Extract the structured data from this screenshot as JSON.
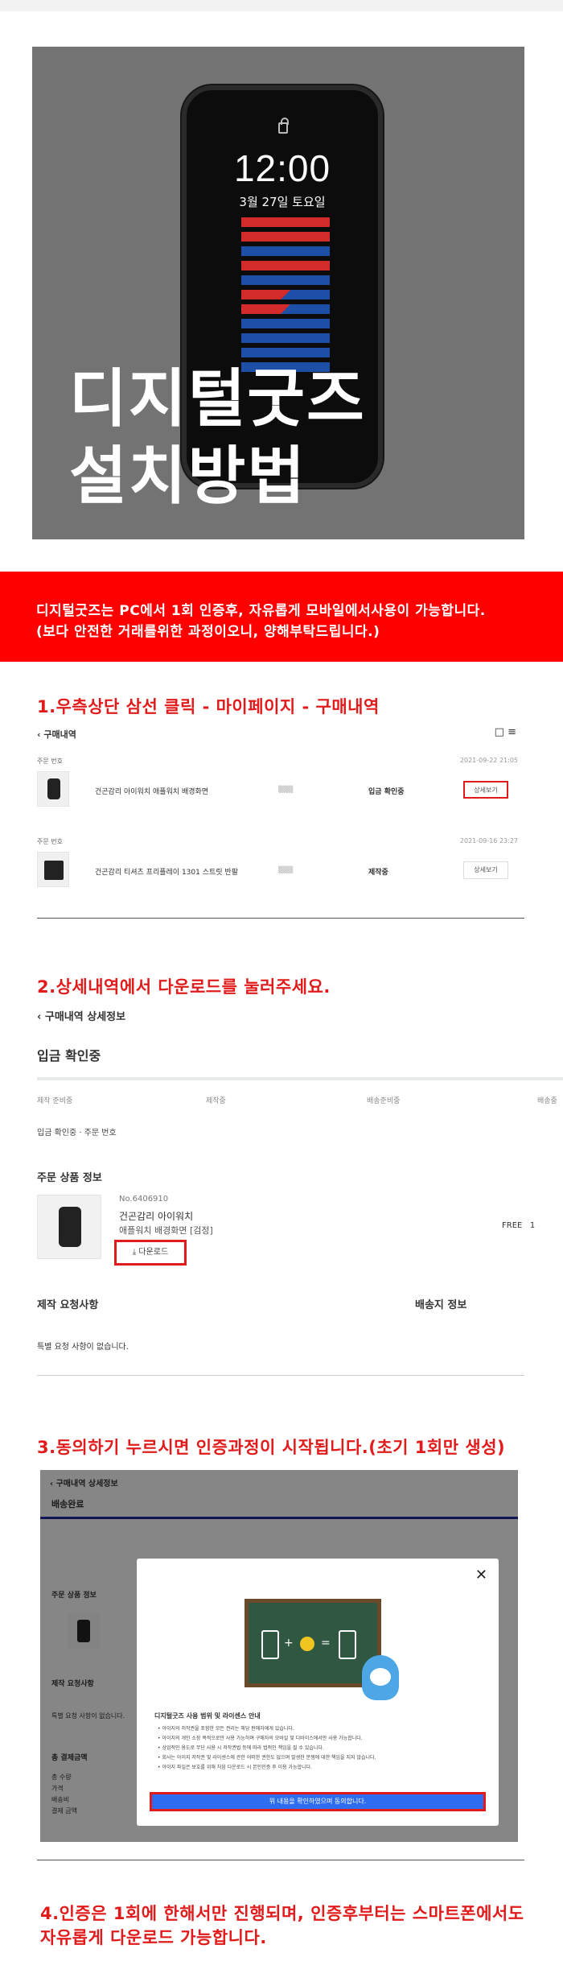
{
  "hero": {
    "title_line1": "디지털굿즈",
    "title_line2": "설치방법",
    "lockscreen_time": "12:00",
    "lockscreen_date": "3월 27일 토요일"
  },
  "notice": {
    "line1": "디지털굿즈는 PC에서 1회 인증후, 자유롭게 모바일에서사용이 가능합니다.",
    "line2": "(보다 안전한 거래를위한 과정이오니, 양해부탁드립니다.)"
  },
  "step1": {
    "title": "1.우측상단 삼선 클릭 - 마이페이지 - 구매내역",
    "header": "구매내역",
    "orders": [
      {
        "no": "주문 번호",
        "date": "2021-09-22 21:05",
        "name": "건곤감리 아이워치 애플워치 배경화면",
        "status": "입금 확인중",
        "button": "상세보기"
      },
      {
        "no": "주문 번호",
        "date": "2021-09-16 23:27",
        "name": "건곤감리 티셔츠 프리플레이 1301 스트릿 반팔",
        "status": "제작중",
        "button": "상세보기"
      }
    ]
  },
  "step2": {
    "title": "2.상세내역에서 다운로드를 눌러주세요.",
    "header": "구매내역 상세정보",
    "status": "입금 확인중",
    "steps": [
      "제작 준비중",
      "제작중",
      "배송준비중",
      "배송중"
    ],
    "order_info": "입금 확인중 · 주문 번호",
    "product_section": "주문 상품 정보",
    "product_no": "No.6406910",
    "product_name": "건곤감리 아이워치",
    "product_option": "애플워치 배경화면 [검정]",
    "download": "다운로드",
    "free": "FREE",
    "qty": "1",
    "request_section": "제작 요청사항",
    "shipping_section": "배송지 정보",
    "request_text": "특별 요청 사항이 없습니다."
  },
  "step3": {
    "title": "3.동의하기 누르시면 인증과정이 시작됩니다.(초기 1회만 생성)",
    "header": "구매내역 상세정보",
    "status": "배송완료",
    "bg_product": "주문 상품 정보",
    "bg_request": "제작 요청사항",
    "bg_request_text": "특별 요청 사항이 없습니다.",
    "bg_total": "총 결제금액",
    "bg_rows": [
      "총 수량",
      "가격",
      "배송비",
      "결제 금액"
    ],
    "modal_title": "디지털굿즈 사용 범위 및 라이센스 안내",
    "modal_bullets": [
      "아이지의 저작권을 포함한 모든 권리는 해당 판매자에게 있습니다.",
      "아이지의 개인 소장 목적으로만 사용 가능하며 구매자의 모바일 및 디바이스에서만 사용 가능합니다.",
      "상업적인 용도로 무단 사용 시 저작권법 등에 따라 법적인 책임을 질 수 있습니다.",
      "회사는 아이지 저작권 및 라이센스에 관한 어떠한 권한도 없으며 발생한 분쟁에 대한 책임을 지지 않습니다.",
      "아이지 파일은 보호를 위해 처음 다운로드 시 본인인증 후 이용 가능합니다."
    ],
    "agree_button": "위 내용을 확인하였으며 동의합니다."
  },
  "step4": {
    "line1": "4.인증은 1회에 한해서만 진행되며, 인증후부터는 스마트폰에서도",
    "line2": "자유롭게 다운로드 가능합니다."
  },
  "colors": {
    "accent_red": "#e11b1b",
    "band_red": "#ff0000",
    "agree_blue": "#2f6df0"
  }
}
